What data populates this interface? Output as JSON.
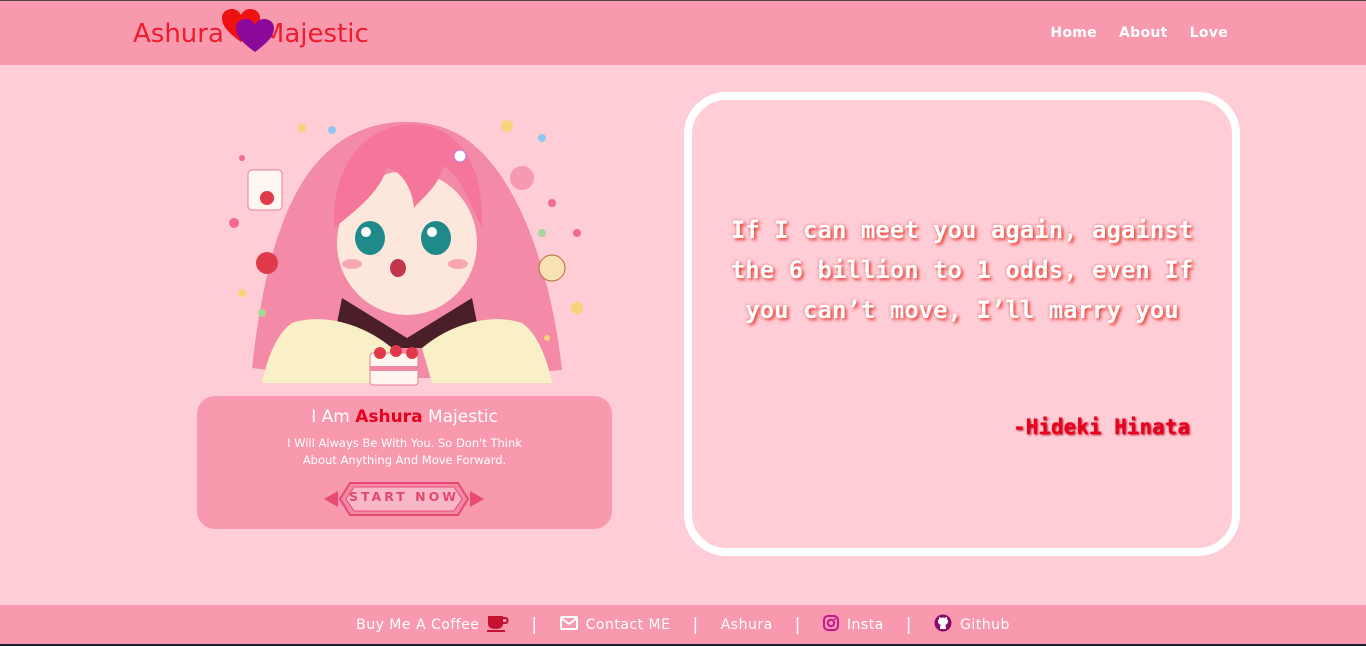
{
  "header": {
    "brand_left": "Ashura",
    "brand_right": "Majestic",
    "nav": [
      "Home",
      "About",
      "Love"
    ]
  },
  "intro": {
    "prefix": "I Am",
    "name": "Ashura",
    "suffix": "Majestic",
    "tagline": "I Will Always Be With You. So Don't Think About Anything And Move Forward.",
    "button_label": "START NOW"
  },
  "quote": {
    "text": "If I can meet you again, against the 6 billion to 1 odds, even If you can’t move, I’ll marry you",
    "author": "-Hideki Hinata"
  },
  "footer": {
    "coffee": "Buy Me A Coffee",
    "contact": "Contact ME",
    "ashura": "Ashura",
    "insta": "Insta",
    "github": "Github",
    "separator": "|"
  },
  "colors": {
    "background": "#ffcdd6",
    "bar": "#f899ae",
    "brand_red": "#ee1c2c",
    "heart_purple": "#8b0a9c"
  },
  "icons": [
    "hearts-logo-icon",
    "coffee-cup-icon",
    "envelope-icon",
    "instagram-icon",
    "github-icon"
  ]
}
